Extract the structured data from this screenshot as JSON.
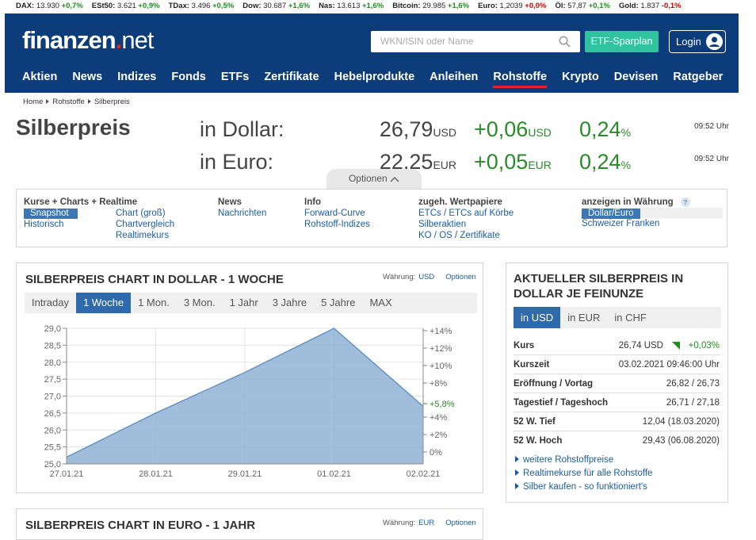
{
  "ticker": [
    {
      "name": "DAX",
      "value": "13.930",
      "change": "+0,7%",
      "dir": "pos"
    },
    {
      "name": "ESt50",
      "value": "3.621",
      "change": "+0,9%",
      "dir": "pos"
    },
    {
      "name": "TDax",
      "value": "3.496",
      "change": "+0,5%",
      "dir": "pos"
    },
    {
      "name": "Dow",
      "value": "30.687",
      "change": "+1,6%",
      "dir": "pos"
    },
    {
      "name": "Nas",
      "value": "13.613",
      "change": "+1,6%",
      "dir": "pos"
    },
    {
      "name": "Bitcoin",
      "value": "29.985",
      "change": "+1,6%",
      "dir": "pos"
    },
    {
      "name": "Euro",
      "value": "1,2039",
      "change": "+0,0%",
      "dir": "neg"
    },
    {
      "name": "Öl",
      "value": "57,87",
      "change": "+0,1%",
      "dir": "pos"
    },
    {
      "name": "Gold",
      "value": "1.837",
      "change": "-0,1%",
      "dir": "neg"
    }
  ],
  "header": {
    "logo_main": "finanzen",
    "logo_dot": ".",
    "logo_net": "net",
    "search_placeholder": "WKN/ISIN oder Name",
    "etf_label": "ETF-Sparplan",
    "login_label": "Login"
  },
  "nav": [
    "Aktien",
    "News",
    "Indizes",
    "Fonds",
    "ETFs",
    "Zertifikate",
    "Hebelprodukte",
    "Anleihen",
    "Rohstoffe",
    "Krypto",
    "Devisen",
    "Ratgeber"
  ],
  "nav_active": "Rohstoffe",
  "breadcrumb": [
    "Home",
    "Rohstoffe",
    "Silberpreis"
  ],
  "page_title": "Silberpreis",
  "prices": [
    {
      "label": "in Dollar:",
      "value": "26,79",
      "unit": "USD",
      "change": "+0,06",
      "change_unit": "USD",
      "pct": "0,24",
      "pct_unit": "%",
      "time": "09:52 Uhr"
    },
    {
      "label": "in Euro:",
      "value": "22,25",
      "unit": "EUR",
      "change": "+0,05",
      "change_unit": "EUR",
      "pct": "0,24",
      "pct_unit": "%",
      "time": "09:52 Uhr"
    }
  ],
  "optionen_label": "Optionen",
  "menu": {
    "col1": {
      "heading": "Kurse + Charts + Realtime",
      "items": [
        "Snapshot",
        "Historisch"
      ]
    },
    "col2": {
      "items": [
        "Chart (groß)",
        "Chartvergleich",
        "Realtimekurs"
      ]
    },
    "col3": {
      "heading": "News",
      "items": [
        "Nachrichten"
      ]
    },
    "col4": {
      "heading": "Info",
      "items": [
        "Forward-Curve",
        "Rohstoff-Indizes"
      ]
    },
    "col5": {
      "heading": "zugeh. Wertpapiere",
      "items": [
        "ETCs / ETCs auf Körbe",
        "Silberaktien",
        "KO / OS / Zertifikate"
      ]
    },
    "col6": {
      "heading": "anzeigen in Währung",
      "help": "?",
      "items": [
        "Dollar/Euro",
        "Schweizer Franken"
      ]
    }
  },
  "chart_box": {
    "title": "SILBERPREIS CHART IN DOLLAR - 1 WOCHE",
    "currency_label": "Währung:",
    "currency": "USD",
    "options": "Optionen",
    "tabs": [
      "Intraday",
      "1 Woche",
      "1 Mon.",
      "3 Mon.",
      "1 Jahr",
      "3 Jahre",
      "5 Jahre",
      "MAX"
    ],
    "active_tab": "1 Woche"
  },
  "chart_data": {
    "type": "area",
    "x": [
      "27.01.21",
      "28.01.21",
      "29.01.21",
      "01.02.21",
      "02.02.21"
    ],
    "values": [
      25.2,
      26.5,
      27.7,
      29.0,
      26.7
    ],
    "ylim": [
      25.0,
      29.0
    ],
    "y_ticks": [
      "29,0",
      "28,5",
      "28,0",
      "27,5",
      "27,0",
      "26,5",
      "26,0",
      "25,5",
      "25,0"
    ],
    "y2_ticks": [
      "+14%",
      "+12%",
      "+10%",
      "+8%",
      "+4%",
      "+2%",
      "0%"
    ],
    "y2_current": "+5,8%",
    "fill_color": "#8fb2d6",
    "line_color": "#5a8cc0"
  },
  "chart_box2": {
    "title": "SILBERPREIS CHART IN EURO - 1 JAHR",
    "currency_label": "Währung:",
    "currency": "EUR",
    "options": "Optionen"
  },
  "side": {
    "title": "AKTUELLER SILBERPREIS IN DOLLAR JE FEINUNZE",
    "tabs": [
      "in USD",
      "in EUR",
      "in CHF"
    ],
    "active_tab": "in USD",
    "rows": [
      {
        "k": "Kurs",
        "v": "26,74 USD",
        "chg": "+0,03%"
      },
      {
        "k": "Kurszeit",
        "v": "03.02.2021 09:46:00 Uhr"
      },
      {
        "k": "Eröffnung / Vortag",
        "v": "26,82 / 26,73"
      },
      {
        "k": "Tageshoch",
        "k_pre": "Tagestief / ",
        "v": "26,71 / 27,18"
      },
      {
        "k": "52 W. Tief",
        "v": "12,04 (18.03.2020)"
      },
      {
        "k": "52 W. Hoch",
        "v": "29,43 (06.08.2020)"
      }
    ],
    "links": [
      "weitere Rohstoffpreise",
      "Realtimekurse für alle Rohstoffe",
      "Silber kaufen - so funktioniert's"
    ]
  },
  "colors": {
    "header_bg": "#0c3c7a",
    "accent_red": "#e5202a",
    "etf_green": "#2fc39f",
    "link_blue": "#1a5d9e",
    "positive": "#2a8a2a"
  }
}
